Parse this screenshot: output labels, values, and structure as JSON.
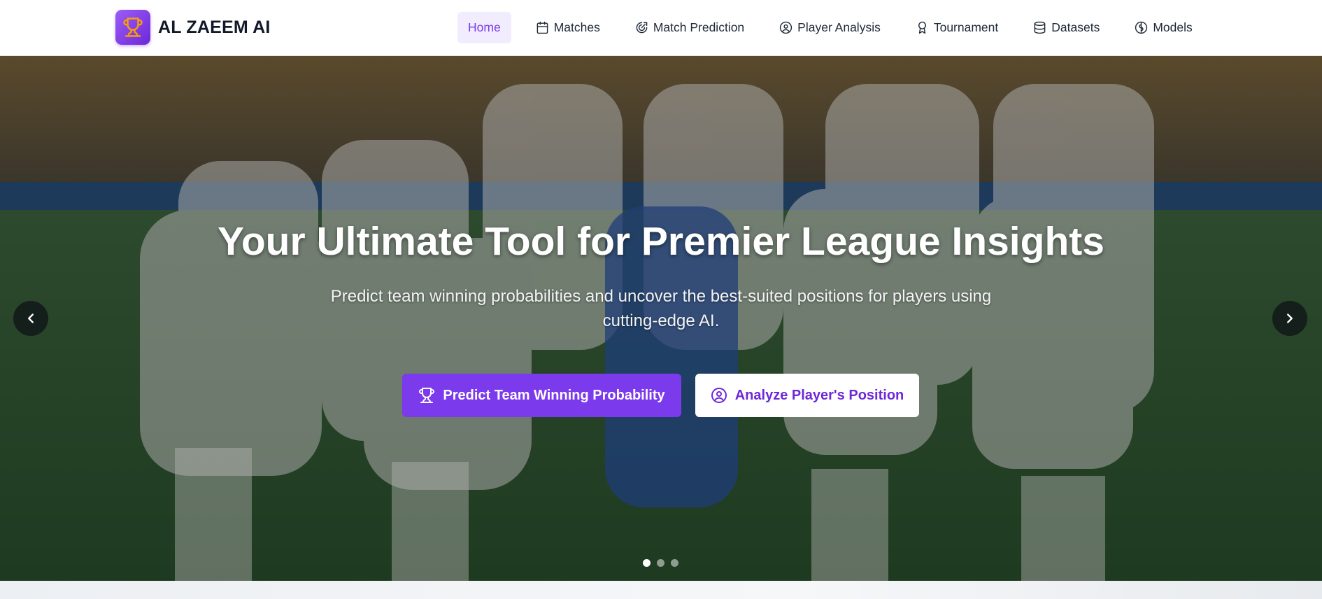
{
  "brand": {
    "name": "AL ZAEEM AI",
    "logo_icon": "trophy-icon",
    "accent_color": "#7c3aed"
  },
  "nav": {
    "items": [
      {
        "label": "Home",
        "icon": "",
        "active": true
      },
      {
        "label": "Matches",
        "icon": "calendar-icon",
        "active": false
      },
      {
        "label": "Match Prediction",
        "icon": "gauge-icon",
        "active": false
      },
      {
        "label": "Player Analysis",
        "icon": "user-circle-icon",
        "active": false
      },
      {
        "label": "Tournament",
        "icon": "award-icon",
        "active": false
      },
      {
        "label": "Datasets",
        "icon": "database-icon",
        "active": false
      },
      {
        "label": "Models",
        "icon": "brain-icon",
        "active": false
      }
    ]
  },
  "hero": {
    "title": "Your Ultimate Tool for Premier League Insights",
    "subtitle": "Predict team winning probabilities and uncover the best-suited positions for players using cutting-edge AI.",
    "primary_button": {
      "label": "Predict Team Winning Probability",
      "icon": "trophy-icon"
    },
    "secondary_button": {
      "label": "Analyze Player's Position",
      "icon": "user-circle-icon"
    },
    "carousel": {
      "slide_count": 3,
      "active_slide": 1
    }
  }
}
